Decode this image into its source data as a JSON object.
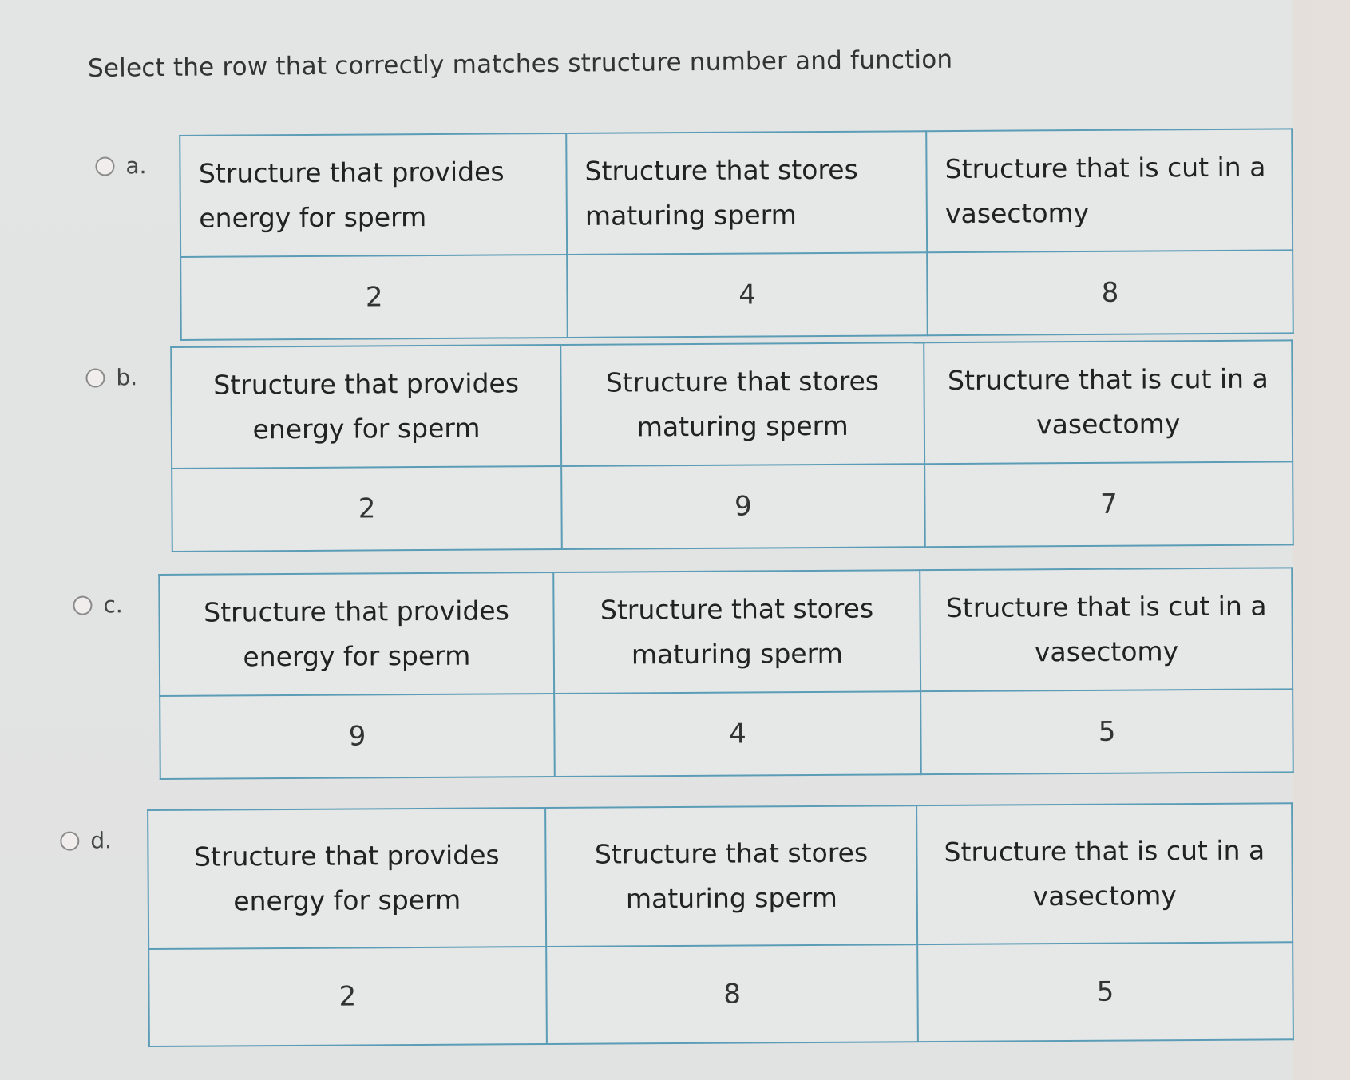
{
  "question": "Select the row that correctly matches structure number and function",
  "headers": [
    "Structure that provides energy for sperm",
    "Structure that stores maturing sperm",
    "Structure that is cut in a vasectomy"
  ],
  "options": [
    {
      "letter": "a.",
      "selected": false,
      "values": [
        "2",
        "4",
        "8"
      ]
    },
    {
      "letter": "b.",
      "selected": false,
      "values": [
        "2",
        "9",
        "7"
      ]
    },
    {
      "letter": "c.",
      "selected": false,
      "values": [
        "9",
        "4",
        "5"
      ]
    },
    {
      "letter": "d.",
      "selected": false,
      "values": [
        "2",
        "8",
        "5"
      ]
    }
  ]
}
